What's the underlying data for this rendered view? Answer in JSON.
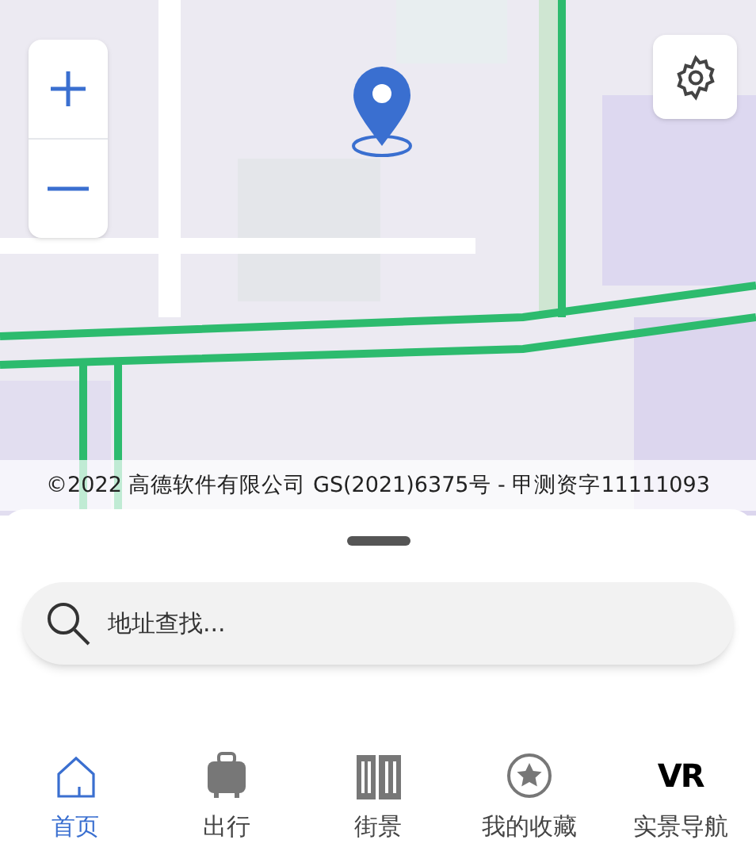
{
  "copyright": "©2022 高德软件有限公司 GS(2021)6375号 - 甲测资字11111093",
  "search": {
    "placeholder": "地址查找..."
  },
  "nav": [
    {
      "kind": "home",
      "label": "首页",
      "selected": true
    },
    {
      "kind": "luggage",
      "label": "出行",
      "selected": false
    },
    {
      "kind": "buildings",
      "label": "街景",
      "selected": false
    },
    {
      "kind": "star",
      "label": "我的收藏",
      "selected": false
    },
    {
      "kind": "vr",
      "label": "实景导航",
      "icon_text": "VR",
      "selected": false
    }
  ]
}
